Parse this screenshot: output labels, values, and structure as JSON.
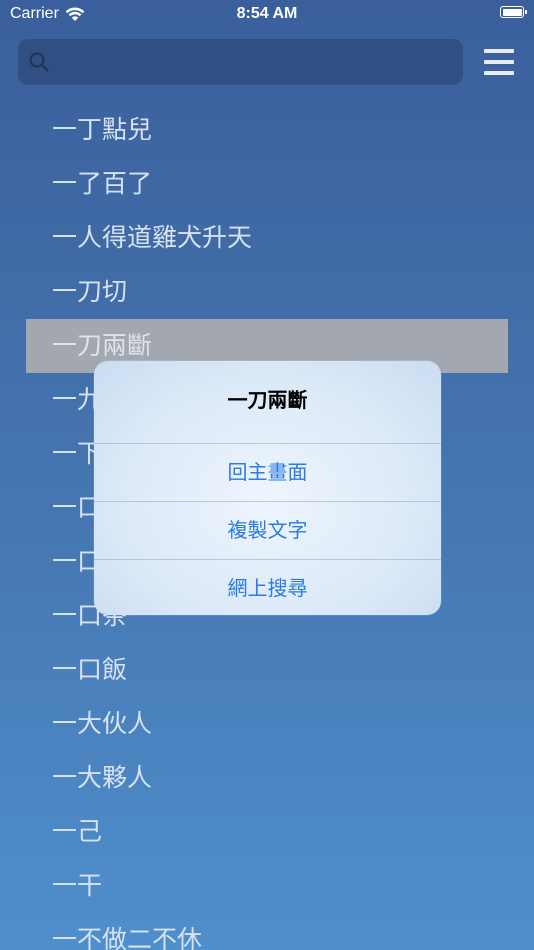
{
  "status_bar": {
    "carrier": "Carrier",
    "time": "8:54 AM"
  },
  "search": {
    "placeholder": "",
    "value": ""
  },
  "list": {
    "items": [
      "一丁點兒",
      "一了百了",
      "一人得道雞犬升天",
      "一刀切",
      "一刀兩斷",
      "一九",
      "一下",
      "一口",
      "一口",
      "一口茶",
      "一口飯",
      "一大伙人",
      "一大夥人",
      "一己",
      "一干",
      "一不做二不休"
    ],
    "selected_index": 4
  },
  "popup": {
    "title": "一刀兩斷",
    "actions": [
      "回主畫面",
      "複製文字",
      "網上搜尋"
    ]
  }
}
